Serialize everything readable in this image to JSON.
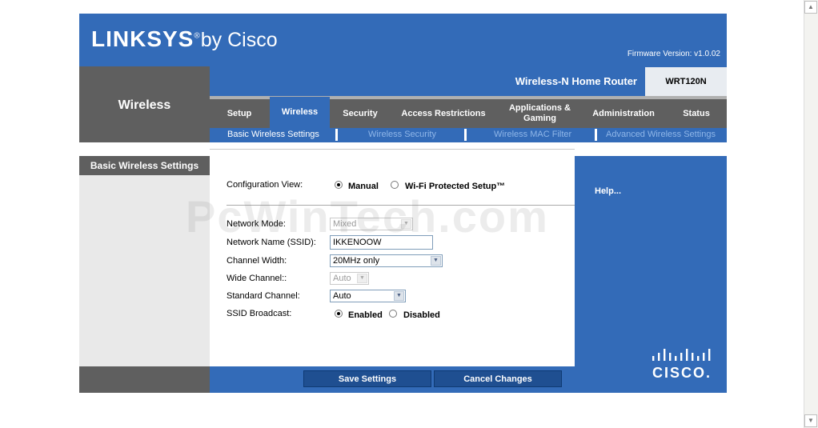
{
  "header": {
    "logo_main": "LINKSYS",
    "logo_reg": "®",
    "logo_by": "by Cisco",
    "firmware": "Firmware Version: v1.0.02",
    "product_name": "Wireless-N Home Router",
    "model": "WRT120N"
  },
  "section_title": "Wireless",
  "nav": {
    "tabs": [
      "Setup",
      "Wireless",
      "Security",
      "Access Restrictions",
      "Applications & Gaming",
      "Administration",
      "Status"
    ],
    "active_tab": "Wireless",
    "subtabs": [
      "Basic Wireless Settings",
      "Wireless Security",
      "Wireless MAC Filter",
      "Advanced Wireless Settings"
    ],
    "active_subtab": "Basic Wireless Settings"
  },
  "sidebar": {
    "section_label": "Basic Wireless Settings"
  },
  "form": {
    "config_view_label": "Configuration View:",
    "config_view_options": [
      "Manual",
      "Wi-Fi Protected Setup™"
    ],
    "config_view_selected": "Manual",
    "network_mode_label": "Network Mode:",
    "network_mode_value": "Mixed",
    "ssid_label": "Network Name (SSID):",
    "ssid_value": "IKKENOOW",
    "channel_width_label": "Channel Width:",
    "channel_width_value": "20MHz only",
    "wide_channel_label": "Wide Channel::",
    "wide_channel_value": "Auto",
    "standard_channel_label": "Standard Channel:",
    "standard_channel_value": "Auto",
    "ssid_broadcast_label": "SSID Broadcast:",
    "ssid_broadcast_options": [
      "Enabled",
      "Disabled"
    ],
    "ssid_broadcast_selected": "Enabled"
  },
  "help": {
    "label": "Help..."
  },
  "buttons": {
    "save": "Save Settings",
    "cancel": "Cancel Changes"
  },
  "watermark": "PcWinTech.com",
  "colors": {
    "brand_blue": "#336bb8",
    "nav_grey": "#5f5f5f",
    "button_blue": "#1f4f91"
  },
  "cisco_logo_text": "CISCO."
}
